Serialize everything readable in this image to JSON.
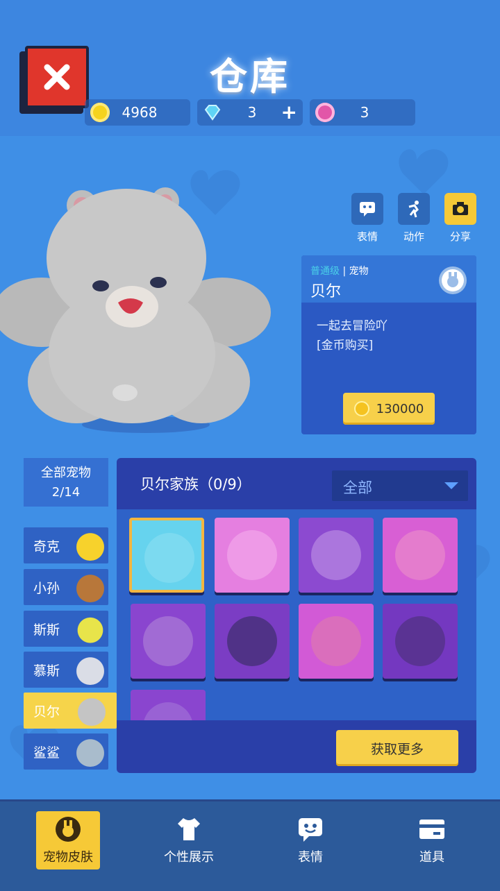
{
  "header": {
    "title": "仓库",
    "currencies": [
      {
        "icon": "gold-coin-icon",
        "value": "4968",
        "color": "#f5d31e"
      },
      {
        "icon": "diamond-icon",
        "value": "3",
        "color": "#5fd3f5"
      },
      {
        "icon": "lotus-icon",
        "value": "3",
        "color": "#e256a8"
      }
    ]
  },
  "actions": [
    {
      "icon": "emote-icon",
      "label": "表情"
    },
    {
      "icon": "action-icon",
      "label": "动作"
    },
    {
      "icon": "camera-icon",
      "label": "分享"
    }
  ],
  "info": {
    "tier": "普通级",
    "divider": "|",
    "type": "宠物",
    "name": "贝尔",
    "desc_line1": "一起去冒险吖",
    "desc_line2": "[金币购买]",
    "price": "130000"
  },
  "categories": {
    "all_label": "全部宠物",
    "all_count": "2/14",
    "items": [
      {
        "label": "奇克",
        "icon": "chick-icon"
      },
      {
        "label": "小孙",
        "icon": "monkey-icon"
      },
      {
        "label": "斯斯",
        "icon": "snake-icon"
      },
      {
        "label": "慕斯",
        "icon": "mouse-icon"
      },
      {
        "label": "贝尔",
        "icon": "bear-icon"
      },
      {
        "label": "鲨鲨",
        "icon": "shark-icon"
      }
    ]
  },
  "skins": {
    "family_title": "贝尔家族（0/9）",
    "filter": "全部",
    "more_label": "获取更多"
  },
  "nav": {
    "items": [
      {
        "label": "宠物皮肤",
        "icon": "pet-skin-icon"
      },
      {
        "label": "个性展示",
        "icon": "tshirt-icon"
      },
      {
        "label": "表情",
        "icon": "emote-icon"
      },
      {
        "label": "道具",
        "icon": "card-icon"
      }
    ]
  }
}
